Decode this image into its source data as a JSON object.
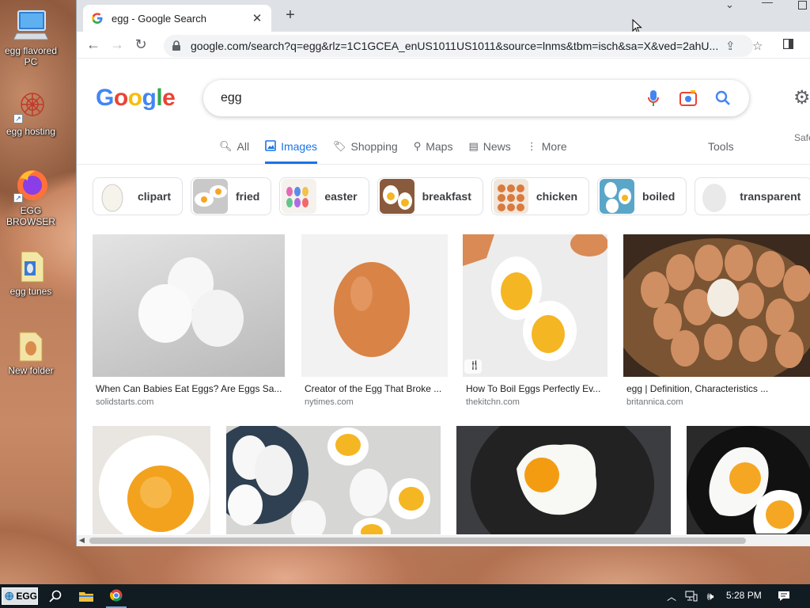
{
  "desktop": {
    "icons": [
      {
        "label": "egg flavored PC",
        "icon": "computer-icon"
      },
      {
        "label": "egg hosting",
        "icon": "app-icon"
      },
      {
        "label": "EGG BROWSER",
        "icon": "firefox-icon"
      },
      {
        "label": "egg tunes",
        "icon": "file-icon"
      },
      {
        "label": "New folder",
        "icon": "folder-icon"
      }
    ]
  },
  "browser": {
    "tab_title": "egg - Google Search",
    "url": "google.com/search?q=egg&rlz=1C1GCEA_enUS1011US1011&source=lnms&tbm=isch&sa=X&ved=2ahU..."
  },
  "google": {
    "logo": "Google",
    "query": "egg",
    "safe_text": "Safe",
    "tabs": [
      {
        "label": "All",
        "icon": "search-icon"
      },
      {
        "label": "Images",
        "icon": "image-icon",
        "active": true
      },
      {
        "label": "Shopping",
        "icon": "tag-icon"
      },
      {
        "label": "Maps",
        "icon": "pin-icon"
      },
      {
        "label": "News",
        "icon": "news-icon"
      },
      {
        "label": "More",
        "icon": "more-icon"
      }
    ],
    "tools_label": "Tools",
    "chips": [
      "clipart",
      "fried",
      "easter",
      "breakfast",
      "chicken",
      "boiled",
      "transparent"
    ],
    "results": [
      {
        "caption": "When Can Babies Eat Eggs? Are Eggs Sa...",
        "source": "solidstarts.com"
      },
      {
        "caption": "Creator of the Egg That Broke ...",
        "source": "nytimes.com"
      },
      {
        "caption": "How To Boil Eggs Perfectly Ev...",
        "source": "thekitchn.com"
      },
      {
        "caption": "egg | Definition, Characteristics ...",
        "source": "britannica.com"
      }
    ]
  },
  "taskbar": {
    "start_label": "EGG",
    "time": "5:28 PM"
  },
  "colors": {
    "google_blue": "#4285f4",
    "google_red": "#ea4335",
    "google_yellow": "#fbbc05",
    "google_green": "#34a853",
    "active_tab": "#1a73e8"
  }
}
